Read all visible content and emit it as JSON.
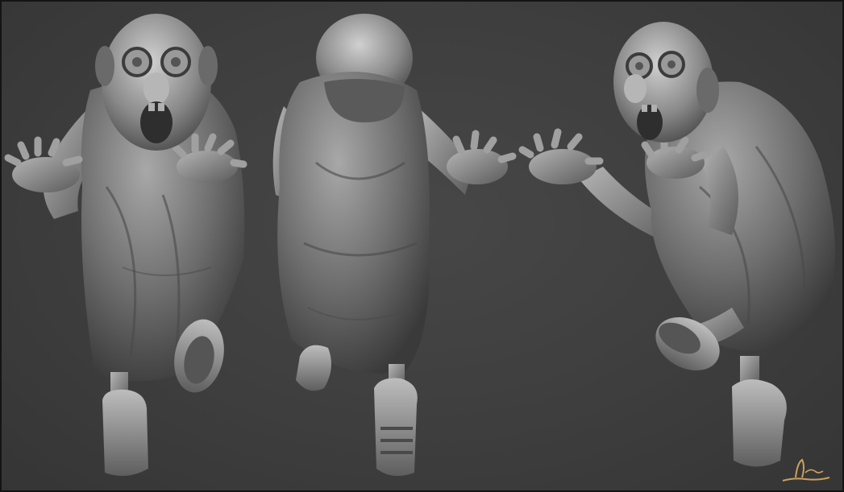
{
  "scene": {
    "background_color": "#3f3f3f",
    "frame_color": "#141414",
    "clay_light": "#c4c4c4",
    "clay_mid": "#7d7d7d",
    "clay_dark": "#3a3a3a",
    "signature_color": "#c9a15a"
  },
  "views": [
    {
      "id": "front",
      "depiction": "character-front-view"
    },
    {
      "id": "back",
      "depiction": "character-back-view"
    },
    {
      "id": "three-quarter",
      "depiction": "character-three-quarter-view"
    }
  ]
}
